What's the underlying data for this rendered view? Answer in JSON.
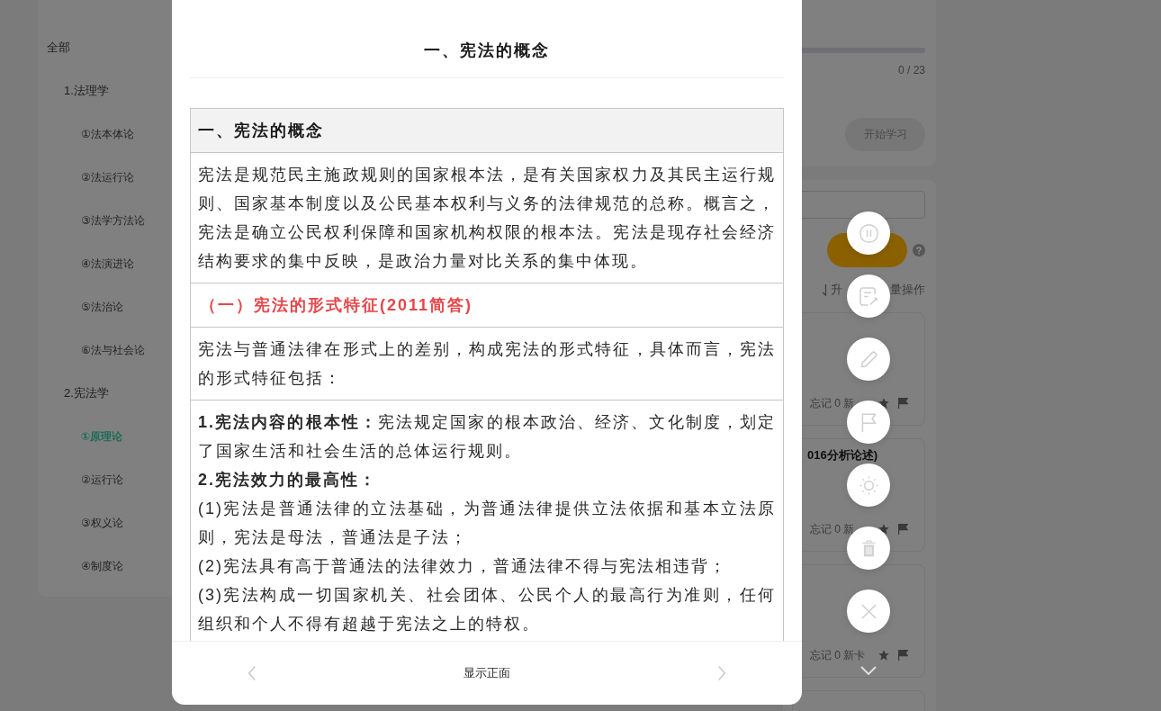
{
  "sidebar": {
    "items": [
      {
        "label": "全部",
        "selected": false,
        "children": [
          {
            "label": "1.法理学",
            "selected": false,
            "children": [
              {
                "label": "①法本体论",
                "selected": false
              },
              {
                "label": "②法运行论",
                "selected": false
              },
              {
                "label": "③法学方法论",
                "selected": false
              },
              {
                "label": "④法演进论",
                "selected": false
              },
              {
                "label": "⑤法治论",
                "selected": false
              },
              {
                "label": "⑥法与社会论",
                "selected": false
              }
            ]
          },
          {
            "label": "2.宪法学",
            "selected": false,
            "children": [
              {
                "label": "①原理论",
                "selected": true
              },
              {
                "label": "②运行论",
                "selected": false
              },
              {
                "label": "③权义论",
                "selected": false
              },
              {
                "label": "④制度论",
                "selected": false
              }
            ]
          }
        ]
      }
    ]
  },
  "progress": {
    "level": 0,
    "count": "0 / 23"
  },
  "start_button": {
    "label": "开始学习"
  },
  "list_toolbar": {
    "sort_label": "升",
    "batch_label": "量操作"
  },
  "cards": [
    {
      "stats": "忘记 0 新"
    },
    {
      "title": "016分析论述)",
      "stats": "忘记 0 新"
    },
    {
      "stats": "忘记 0 新卡"
    }
  ],
  "modal": {
    "title": "一、宪法的概念",
    "rows": [
      {
        "kind": "heading",
        "text": "一、宪法的概念"
      },
      {
        "kind": "text",
        "text": "宪法是规范民主施政规则的国家根本法，是有关国家权力及其民主运行规则、国家基本制度以及公民基本权利与义务的法律规范的总称。概言之，宪法是确立公民权利保障和国家机构权限的根本法。宪法是现存社会经济结构要求的集中反映，是政治力量对比关系的集中体现。"
      },
      {
        "kind": "subheading",
        "text": "（一）宪法的形式特征(2011简答)"
      },
      {
        "kind": "text",
        "text": "宪法与普通法律在形式上的差别，构成宪法的形式特征，具体而言，宪法的形式特征包括："
      },
      {
        "kind": "list",
        "lines": [
          {
            "kind": "plain",
            "text": "**1.宪法内容的根本性：**宪法规定国家的根本政治、经济、文化制度，划定了国家生活和社会生活的总体运行规则。"
          },
          {
            "kind": "bold",
            "text": "2.宪法效力的最高性："
          },
          {
            "kind": "plain",
            "text": "(1)宪法是普通法律的立法基础，为普通法律提供立法依据和基本立法原则，宪法是母法，普通法是子法；"
          },
          {
            "kind": "plain",
            "text": "(2)宪法具有高于普通法的法律效力，普通法律不得与宪法相违背；"
          },
          {
            "kind": "plain",
            "text": "(3)宪法构成一切国家机关、社会团体、公民个人的最高行为准则，任何组织和个人不得有超越于宪法之上的特权。"
          }
        ]
      }
    ],
    "footer_label": "显示正面"
  }
}
